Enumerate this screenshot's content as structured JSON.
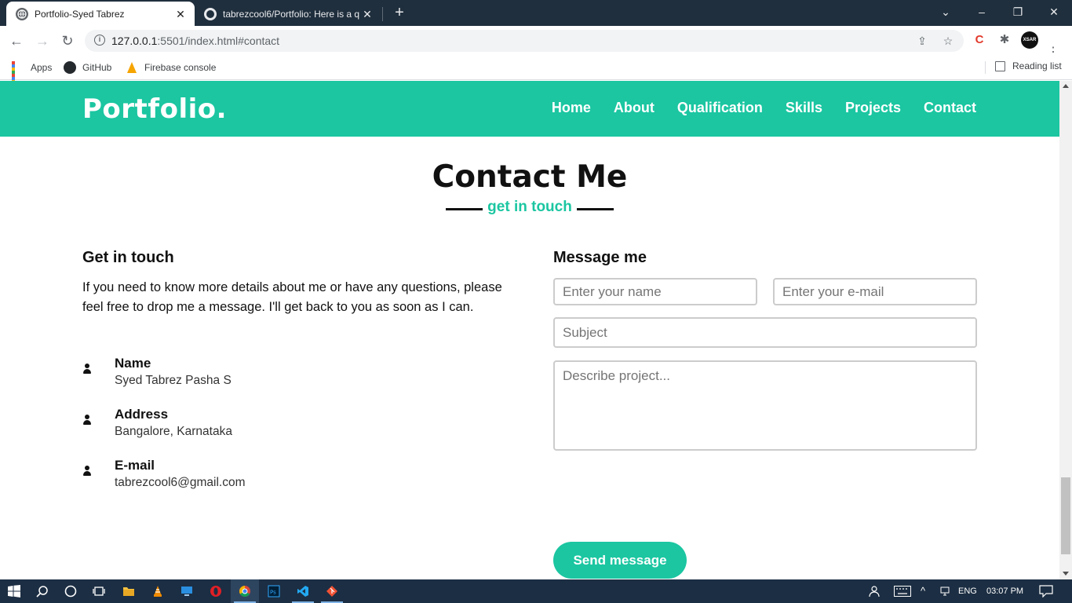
{
  "browser": {
    "tabs": [
      {
        "title": "Portfolio-Syed Tabrez",
        "active": true
      },
      {
        "title": "tabrezcool6/Portfolio: Here is a q",
        "active": false
      }
    ],
    "url_host": "127.0.0.1",
    "url_rest": ":5501/index.html#contact",
    "bookmarks": [
      {
        "label": "Apps",
        "icon": "apps-grid-icon"
      },
      {
        "label": "GitHub",
        "icon": "github-icon"
      },
      {
        "label": "Firebase console",
        "icon": "firebase-icon"
      }
    ],
    "reading_list": "Reading list",
    "profile_badge": "XSAR"
  },
  "site": {
    "logo": "Portfolio.",
    "nav": [
      "Home",
      "About",
      "Qualification",
      "Skills",
      "Projects",
      "Contact"
    ],
    "accent_color": "#1bc6a1"
  },
  "contact": {
    "title": "Contact Me",
    "subtitle": "get in touch",
    "left": {
      "heading": "Get in touch",
      "text": "If you need to know more details about me or have any questions, please feel free to drop me a message. I'll get back to you as soon as I can.",
      "items": [
        {
          "label": "Name",
          "value": "Syed Tabrez Pasha S"
        },
        {
          "label": "Address",
          "value": "Bangalore, Karnataka"
        },
        {
          "label": "E-mail",
          "value": "tabrezcool6@gmail.com"
        }
      ]
    },
    "form": {
      "heading": "Message me",
      "name_placeholder": "Enter your name",
      "email_placeholder": "Enter your e-mail",
      "subject_placeholder": "Subject",
      "message_placeholder": "Describe project...",
      "submit_label": "Send message"
    }
  },
  "taskbar": {
    "language": "ENG",
    "time": "03:07 PM"
  }
}
